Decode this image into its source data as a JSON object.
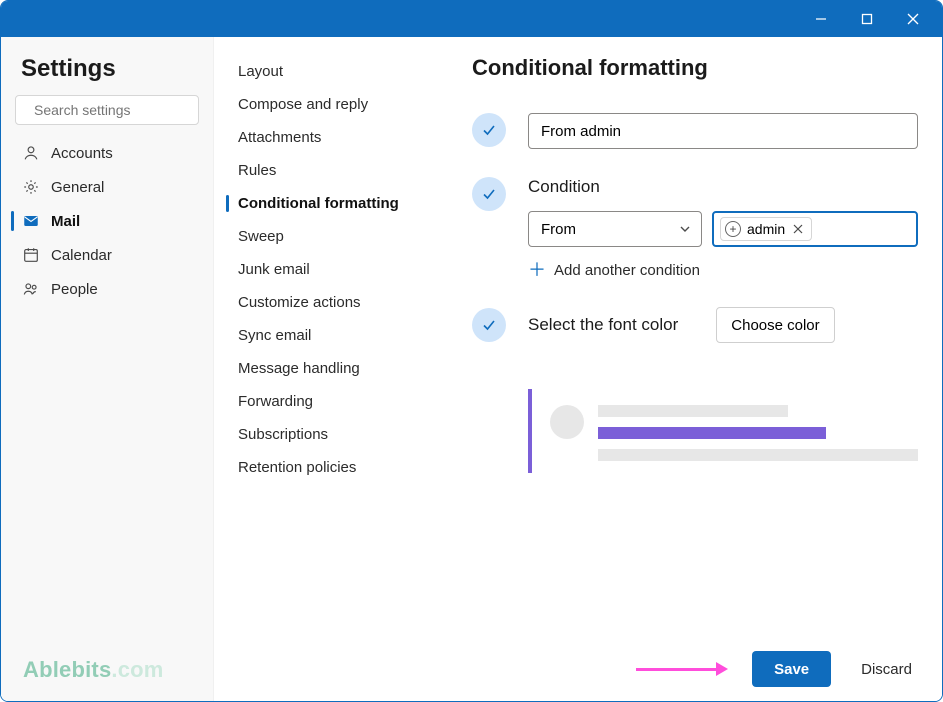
{
  "window": {
    "title": ""
  },
  "settings_header": "Settings",
  "search": {
    "placeholder": "Search settings"
  },
  "nav": {
    "items": [
      {
        "label": "Accounts"
      },
      {
        "label": "General"
      },
      {
        "label": "Mail",
        "active": true
      },
      {
        "label": "Calendar"
      },
      {
        "label": "People"
      }
    ]
  },
  "subnav": {
    "items": [
      {
        "label": "Layout"
      },
      {
        "label": "Compose and reply"
      },
      {
        "label": "Attachments"
      },
      {
        "label": "Rules"
      },
      {
        "label": "Conditional formatting",
        "active": true
      },
      {
        "label": "Sweep"
      },
      {
        "label": "Junk email"
      },
      {
        "label": "Customize actions"
      },
      {
        "label": "Sync email"
      },
      {
        "label": "Message handling"
      },
      {
        "label": "Forwarding"
      },
      {
        "label": "Subscriptions"
      },
      {
        "label": "Retention policies"
      }
    ]
  },
  "page": {
    "title": "Conditional formatting",
    "rule_name": "From admin",
    "condition_heading": "Condition",
    "condition_field": "From",
    "condition_chip": "admin",
    "add_condition": "Add another condition",
    "font_heading": "Select the font color",
    "choose_color": "Choose color",
    "save": "Save",
    "discard": "Discard"
  },
  "watermark": {
    "brand": "Ablebits",
    "suffix": ".com"
  },
  "colors": {
    "accent": "#0f6cbd",
    "purple": "#7b5fd8",
    "arrow": "#ff4ddb"
  }
}
